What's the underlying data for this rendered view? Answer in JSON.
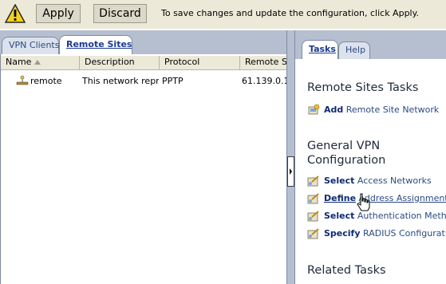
{
  "toolbar": {
    "warning_icon": "warning-icon",
    "apply_label": "Apply",
    "discard_label": "Discard",
    "message": "To save changes and update the configuration, click Apply."
  },
  "left_pane": {
    "tabs": [
      {
        "label": "VPN Clients",
        "active": false
      },
      {
        "label": "Remote Sites",
        "active": true
      }
    ],
    "columns": [
      "Name",
      "Description",
      "Protocol",
      "Remote Se"
    ],
    "rows": [
      {
        "name": "remote",
        "description": "This network repr…",
        "protocol": "PPTP",
        "remote": "61.139.0.1"
      }
    ]
  },
  "right_pane": {
    "tabs": [
      {
        "label": "Tasks",
        "active": true
      },
      {
        "label": "Help",
        "active": false
      }
    ],
    "section_remote_sites": "Remote Sites Tasks",
    "add_task": {
      "verb": "Add",
      "rest": "Remote Site Network"
    },
    "section_general": "General VPN Configuration",
    "general_tasks": [
      {
        "verb": "Select",
        "rest": "Access Networks"
      },
      {
        "verb": "Define",
        "rest": "Address Assignments"
      },
      {
        "verb": "Select",
        "rest": "Authentication Methods"
      },
      {
        "verb": "Specify",
        "rest": "RADIUS Configuration"
      }
    ],
    "section_related": "Related Tasks"
  },
  "colors": {
    "accent": "#1a3a93",
    "panel_bg": "#b6bfd0",
    "toolbar_bg": "#ece9d8"
  }
}
